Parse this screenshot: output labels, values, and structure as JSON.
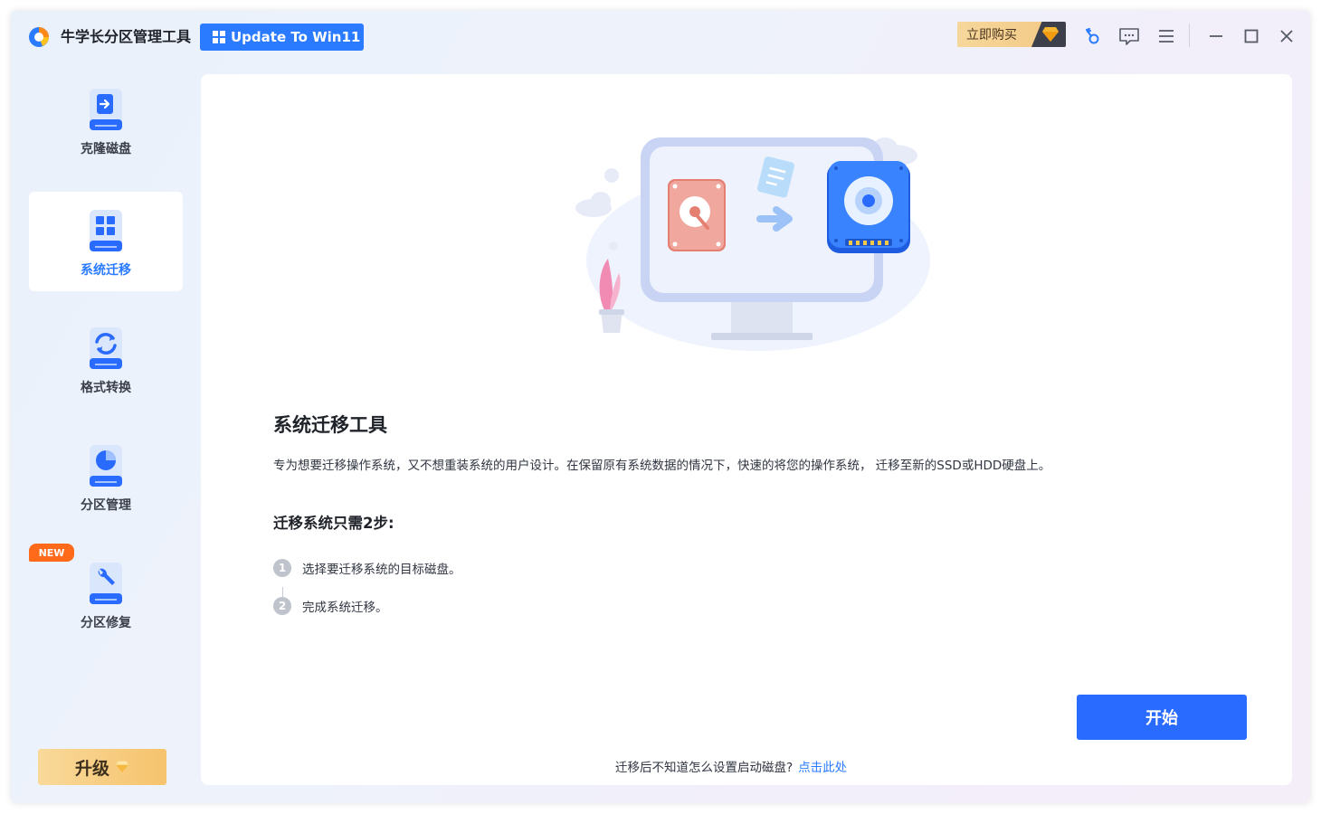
{
  "app": {
    "title": "牛学长分区管理工具",
    "update_button": "Update To Win11",
    "buy_button": "立即购买"
  },
  "colors": {
    "accent": "#2a7bff",
    "start_button": "#2a6bff",
    "upgrade": "#f6c36d",
    "new_badge": "#ff6a1a"
  },
  "titlebar_icons": [
    "key-icon",
    "feedback-icon",
    "menu-icon",
    "minimize-icon",
    "maximize-icon",
    "close-icon"
  ],
  "sidebar": {
    "items": [
      {
        "label": "克隆磁盘",
        "icon": "clone-disk-icon",
        "active": false
      },
      {
        "label": "系统迁移",
        "icon": "system-migrate-icon",
        "active": true
      },
      {
        "label": "格式转换",
        "icon": "format-convert-icon",
        "active": false
      },
      {
        "label": "分区管理",
        "icon": "partition-manage-icon",
        "active": false
      },
      {
        "label": "分区修复",
        "icon": "partition-repair-icon",
        "active": false
      }
    ],
    "new_badge": "NEW",
    "upgrade_button": "升级"
  },
  "main": {
    "title": "系统迁移工具",
    "description": "专为想要迁移操作系统，又不想重装系统的用户设计。在保留原有系统数据的情况下，快速的将您的操作系统， 迁移至新的SSD或HDD硬盘上。",
    "steps_title": "迁移系统只需2步:",
    "steps": [
      {
        "num": "1",
        "text": "选择要迁移系统的目标磁盘。"
      },
      {
        "num": "2",
        "text": "完成系统迁移。"
      }
    ],
    "start_button": "开始",
    "footer_text": "迁移后不知道怎么设置启动磁盘?",
    "footer_link": "点击此处"
  }
}
